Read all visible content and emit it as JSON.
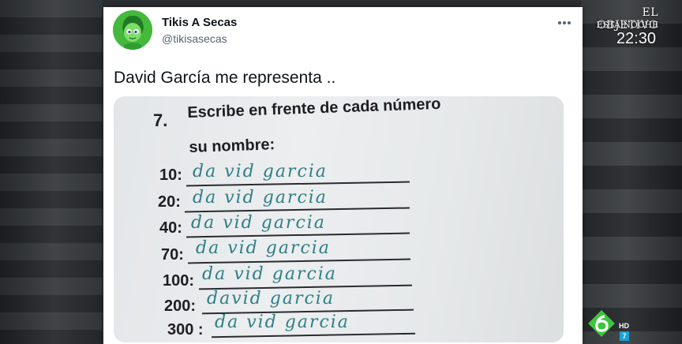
{
  "tweet": {
    "display_name": "Tikis A Secas",
    "handle": "@tikisasecas",
    "text": "David García me representa ..",
    "more_icon": "more-horizontal-icon",
    "avatar_icon": "green-cartoon-avatar"
  },
  "worksheet": {
    "question_number": "7.",
    "question_line1": "Escribe en frente de cada número",
    "question_line2": "su nombre:",
    "rows": [
      {
        "number": "10:",
        "answer": "da vid garcia"
      },
      {
        "number": "20:",
        "answer": "da vid garcia"
      },
      {
        "number": "40:",
        "answer": "da vid garcia"
      },
      {
        "number": "70:",
        "answer": "da vid garcia"
      },
      {
        "number": "100:",
        "answer": "da vid garcia"
      },
      {
        "number": "200:",
        "answer": "david garcia"
      },
      {
        "number": "300 :",
        "answer": "da vid garcia"
      }
    ],
    "ink_color": "#2f7f86"
  },
  "broadcast": {
    "show_title": "EL OBJETIVO",
    "show_subtitle": "ESTA NOCHE",
    "time": "22:30",
    "hd_label": "HD",
    "channel_number": "7",
    "logo_icon": "la-sexta-logo",
    "logo_color": "#3cc63a"
  }
}
